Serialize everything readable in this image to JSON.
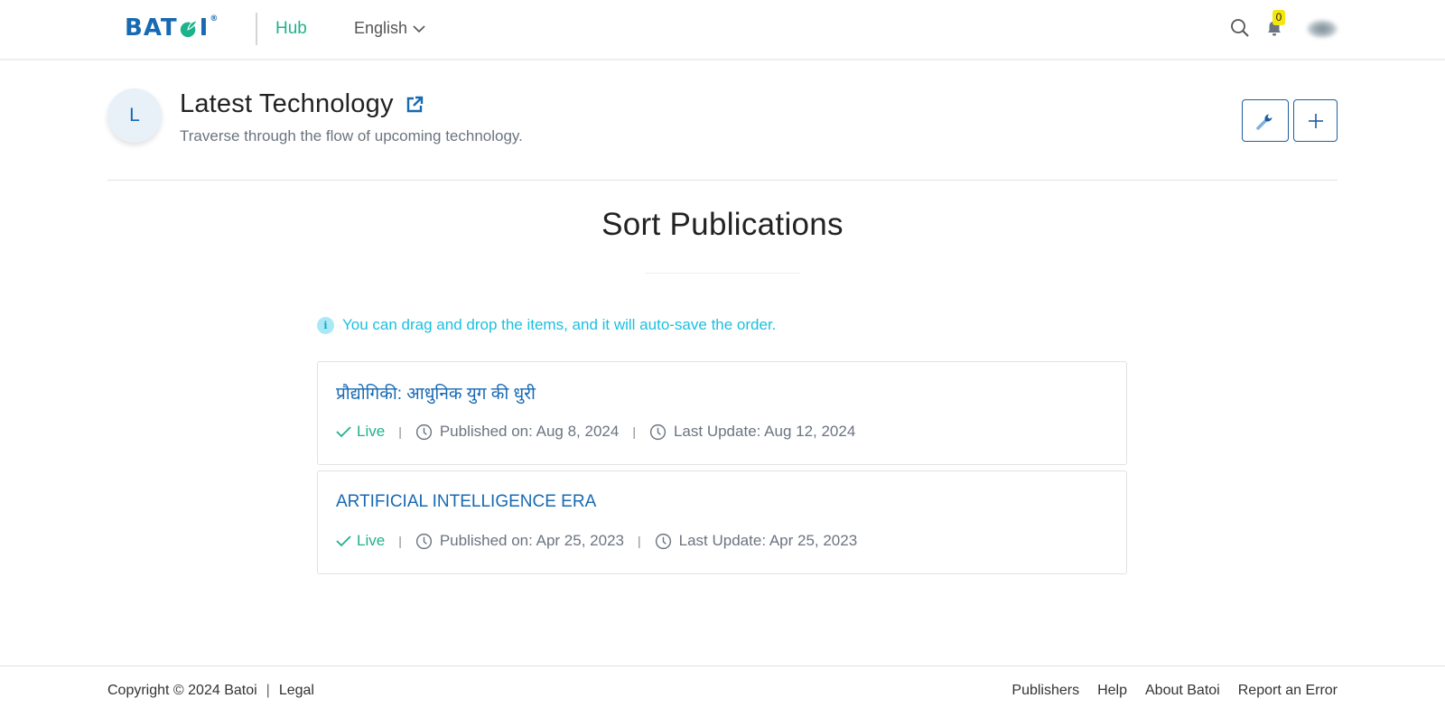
{
  "header": {
    "logo_text_left": "BAT",
    "logo_text_right": "I",
    "logo_registered": "®",
    "section_label": "Hub",
    "language": "English",
    "notification_count": "0",
    "icons": {
      "search": "search-icon",
      "notifications": "bell-icon",
      "avatar": "user-avatar"
    }
  },
  "channel": {
    "avatar_initial": "L",
    "title": "Latest Technology",
    "description": "Traverse through the flow of upcoming technology.",
    "actions": [
      {
        "name": "settings",
        "icon": "wrench-icon"
      },
      {
        "name": "add",
        "icon": "plus-icon"
      }
    ]
  },
  "main": {
    "title": "Sort Publications",
    "info_note": "You can drag and drop the items, and it will auto-save the order.",
    "publications": [
      {
        "title": "प्रौद्योगिकी: आधुनिक युग की धुरी",
        "status": "Live",
        "published": "Published on: Aug 8, 2024",
        "last_update": "Last Update: Aug 12, 2024"
      },
      {
        "title": "ARTIFICIAL INTELLIGENCE ERA",
        "status": "Live",
        "published": "Published on: Apr 25, 2023",
        "last_update": "Last Update: Apr 25, 2023"
      }
    ]
  },
  "footer": {
    "copyright": "Copyright © 2024 Batoi",
    "separator": "|",
    "legal": "Legal",
    "links": [
      "Publishers",
      "Help",
      "About Batoi",
      "Report an Error"
    ]
  },
  "colors": {
    "brand_blue": "#1769b3",
    "brand_green": "#1db38a",
    "info_cyan": "#1cc0e0",
    "badge_yellow": "#f5e60c"
  }
}
